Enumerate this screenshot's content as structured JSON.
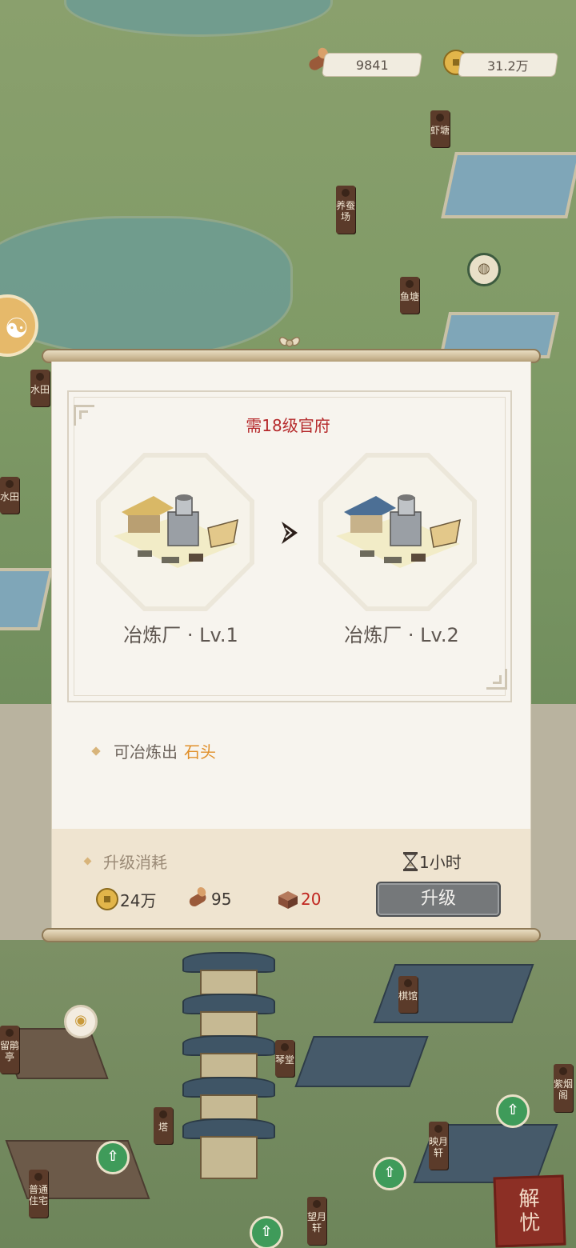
{
  "resources": {
    "wood": "9841",
    "coins": "31.2万"
  },
  "map_labels": {
    "shrimp_pond": "虾塘",
    "silkworm_farm": "养蚕场",
    "fish_pond": "鱼塘",
    "paddy_1": "水田",
    "paddy_2": "水田",
    "chess_hall": "棋馆",
    "zither_hall": "琴堂",
    "pavilion": "留鹃亭",
    "tower": "塔",
    "residence": "普通住宅",
    "moon_pavilion": "望月轩",
    "reflect_moon": "映月轩",
    "purple_smoke": "紫烟阁"
  },
  "dialog": {
    "requirement": "需18级官府",
    "current_level": "冶炼厂 · Lv.1",
    "next_level": "冶炼厂 · Lv.2",
    "produce_prefix": "可冶炼出",
    "produce_item": "石头",
    "cost_title": "升级消耗",
    "duration": "1小时",
    "costs": {
      "coins": "24万",
      "wood": "95",
      "brick": "20"
    },
    "upgrade_button": "升级"
  },
  "stamp": {
    "line1": "解",
    "line2": "忧"
  },
  "colors": {
    "requirement_red": "#b5292b",
    "highlight_orange": "#e0902b",
    "insufficient_red": "#c0261f",
    "button_gray": "#75787a"
  }
}
